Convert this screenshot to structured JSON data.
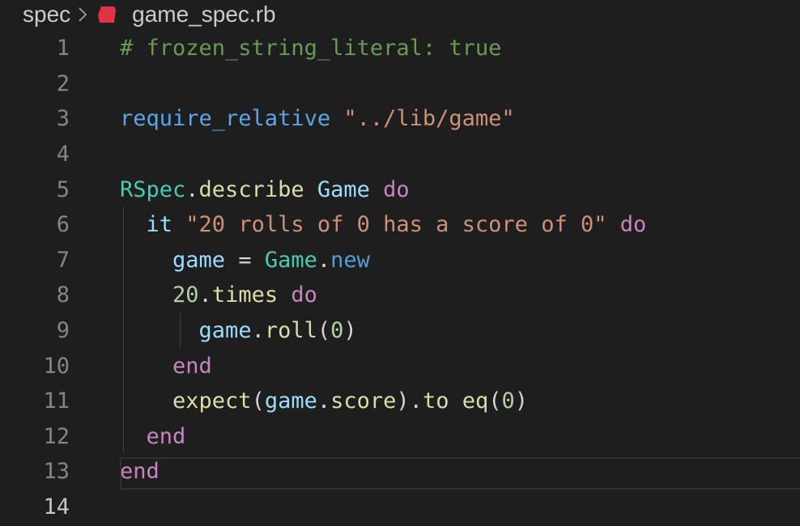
{
  "breadcrumb": {
    "folder": "spec",
    "file": "game_spec.rb"
  },
  "colors": {
    "background": "#1e1e1e",
    "comment": "#6a9955",
    "keyword": "#c586c0",
    "string": "#ce9178",
    "constant": "#4ec9b0",
    "variable": "#9cdcfe",
    "function": "#dcdcaa",
    "ruby_icon": "#e0334a"
  },
  "lines": [
    {
      "n": "1",
      "tokens": [
        {
          "t": "# frozen_string_literal: true",
          "c": "comment"
        }
      ]
    },
    {
      "n": "2",
      "tokens": []
    },
    {
      "n": "3",
      "tokens": [
        {
          "t": "require_relative",
          "c": "fnblue"
        },
        {
          "t": " ",
          "c": "plain"
        },
        {
          "t": "\"../lib/game\"",
          "c": "str"
        }
      ]
    },
    {
      "n": "4",
      "tokens": []
    },
    {
      "n": "5",
      "tokens": [
        {
          "t": "RSpec",
          "c": "const"
        },
        {
          "t": ".",
          "c": "plain"
        },
        {
          "t": "describe",
          "c": "func"
        },
        {
          "t": " ",
          "c": "plain"
        },
        {
          "t": "Game",
          "c": "const2"
        },
        {
          "t": " ",
          "c": "plain"
        },
        {
          "t": "do",
          "c": "kw"
        }
      ]
    },
    {
      "n": "6",
      "tokens": [
        {
          "t": "  ",
          "c": "plain"
        },
        {
          "t": "it",
          "c": "var"
        },
        {
          "t": " ",
          "c": "plain"
        },
        {
          "t": "\"20 rolls of 0 has a score of 0\"",
          "c": "str"
        },
        {
          "t": " ",
          "c": "plain"
        },
        {
          "t": "do",
          "c": "kw"
        }
      ]
    },
    {
      "n": "7",
      "tokens": [
        {
          "t": "    ",
          "c": "plain"
        },
        {
          "t": "game",
          "c": "var"
        },
        {
          "t": " = ",
          "c": "plain"
        },
        {
          "t": "Game",
          "c": "const"
        },
        {
          "t": ".",
          "c": "plain"
        },
        {
          "t": "new",
          "c": "blue"
        }
      ]
    },
    {
      "n": "8",
      "tokens": [
        {
          "t": "    ",
          "c": "plain"
        },
        {
          "t": "20",
          "c": "num"
        },
        {
          "t": ".",
          "c": "plain"
        },
        {
          "t": "times",
          "c": "func"
        },
        {
          "t": " ",
          "c": "plain"
        },
        {
          "t": "do",
          "c": "kw"
        }
      ]
    },
    {
      "n": "9",
      "tokens": [
        {
          "t": "      ",
          "c": "plain"
        },
        {
          "t": "game",
          "c": "var"
        },
        {
          "t": ".",
          "c": "plain"
        },
        {
          "t": "roll",
          "c": "func"
        },
        {
          "t": "(",
          "c": "plain"
        },
        {
          "t": "0",
          "c": "num"
        },
        {
          "t": ")",
          "c": "plain"
        }
      ]
    },
    {
      "n": "10",
      "tokens": [
        {
          "t": "    ",
          "c": "plain"
        },
        {
          "t": "end",
          "c": "kw"
        }
      ]
    },
    {
      "n": "11",
      "tokens": [
        {
          "t": "    ",
          "c": "plain"
        },
        {
          "t": "expect",
          "c": "func"
        },
        {
          "t": "(",
          "c": "plain"
        },
        {
          "t": "game",
          "c": "var"
        },
        {
          "t": ".",
          "c": "plain"
        },
        {
          "t": "score",
          "c": "func"
        },
        {
          "t": ").",
          "c": "plain"
        },
        {
          "t": "to",
          "c": "func"
        },
        {
          "t": " ",
          "c": "plain"
        },
        {
          "t": "eq",
          "c": "func"
        },
        {
          "t": "(",
          "c": "plain"
        },
        {
          "t": "0",
          "c": "num"
        },
        {
          "t": ")",
          "c": "plain"
        }
      ]
    },
    {
      "n": "12",
      "tokens": [
        {
          "t": "  ",
          "c": "plain"
        },
        {
          "t": "end",
          "c": "kw"
        }
      ]
    },
    {
      "n": "13",
      "tokens": [
        {
          "t": "end",
          "c": "kw"
        }
      ]
    },
    {
      "n": "14",
      "tokens": []
    }
  ]
}
